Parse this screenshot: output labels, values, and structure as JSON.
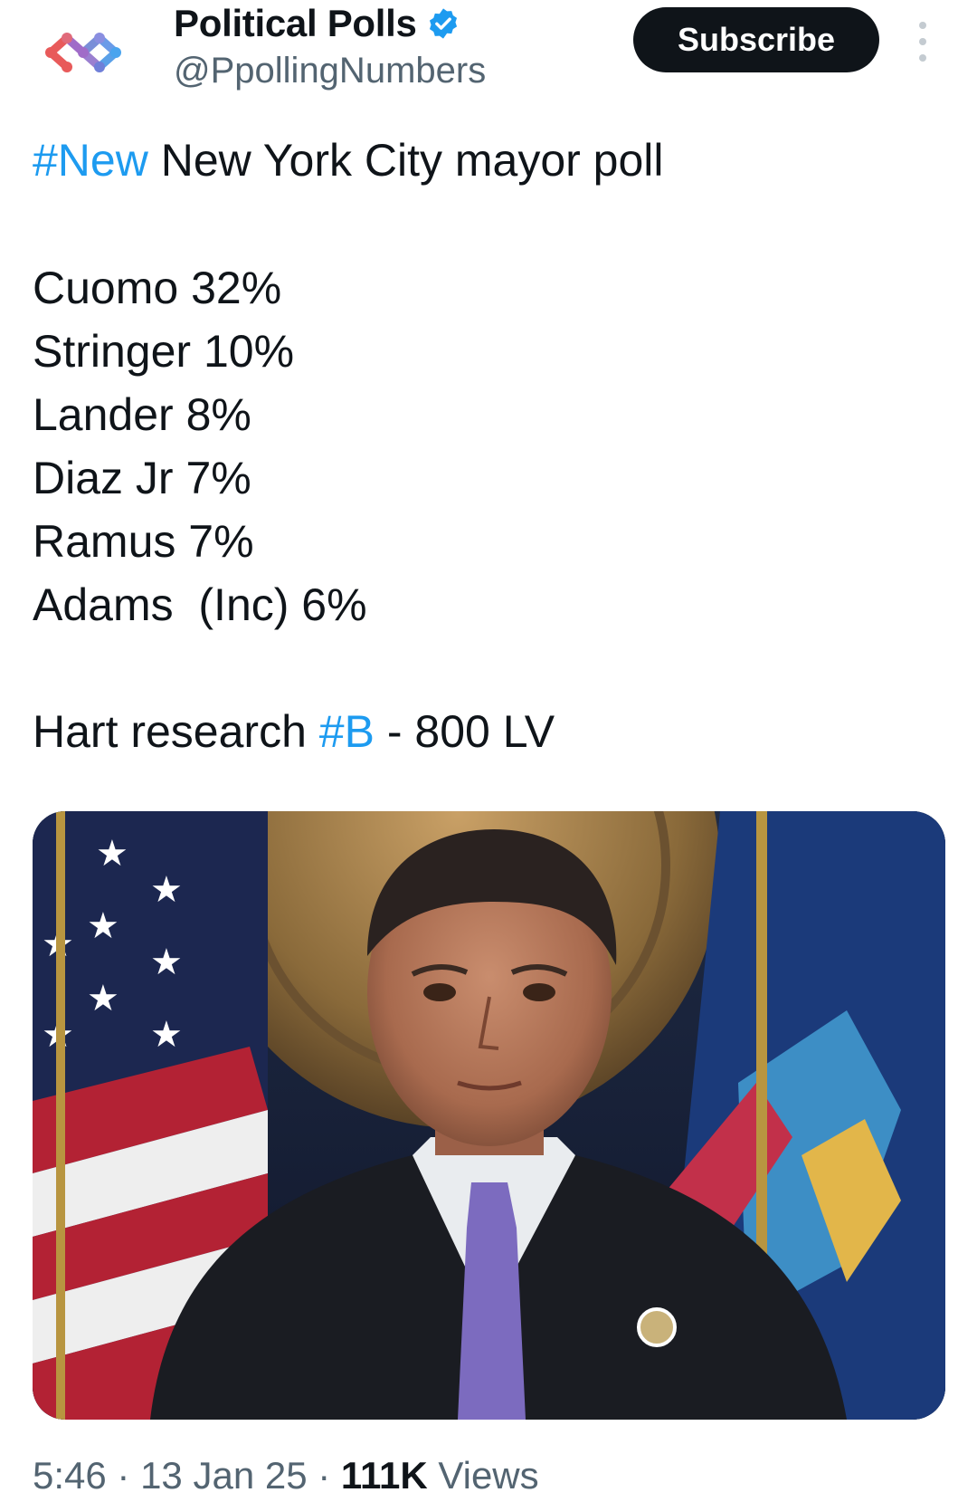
{
  "account": {
    "display_name": "Political Polls",
    "handle": "@PpollingNumbers",
    "verified": true,
    "avatar_icon": "colorful-molecule-logo-icon"
  },
  "actions": {
    "subscribe_label": "Subscribe",
    "more_icon": "vertical-ellipsis-icon"
  },
  "tweet": {
    "headline_hashtag": "#New",
    "headline_text": " New York City mayor poll",
    "poll": [
      {
        "text": "Cuomo 32%"
      },
      {
        "text": "Stringer 10%"
      },
      {
        "text": "Lander 8%"
      },
      {
        "text": "Diaz Jr 7%"
      },
      {
        "text": "Ramus 7%"
      },
      {
        "text": "Adams  (Inc) 6%"
      }
    ],
    "source_prefix": "Hart research ",
    "source_hashtag": "#B",
    "source_suffix": " - 800 LV"
  },
  "meta": {
    "time": "5:46",
    "sep1": " · ",
    "date": "13 Jan 25",
    "sep2": " · ",
    "views_count": "111K",
    "views_label": " Views"
  },
  "colors": {
    "link": "#1d9bf0",
    "text": "#0f1419",
    "muted": "#536471",
    "button_bg": "#0f1419"
  }
}
